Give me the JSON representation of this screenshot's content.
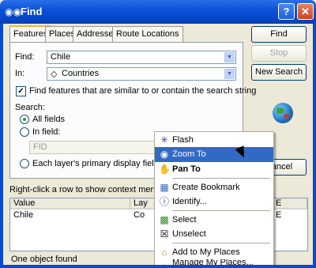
{
  "window": {
    "title": "Find",
    "help_glyph": "?",
    "close_glyph": "✕",
    "icon": "binoculars-icon"
  },
  "tabs": [
    {
      "label": "Features",
      "active": true
    },
    {
      "label": "Places",
      "active": false
    },
    {
      "label": "Addresses",
      "active": false
    },
    {
      "label": "Route Locations",
      "active": false
    }
  ],
  "form": {
    "find_label": "Find:",
    "find_value": "Chile",
    "in_label": "In:",
    "in_value": "Countries",
    "similar_checkbox_label": "Find features that are similar to or contain the search string",
    "similar_checked": true,
    "search_label": "Search:",
    "all_fields_label": "All fields",
    "in_field_label": "In field:",
    "in_field_value": "FID",
    "primary_display_label": "Each layer's primary display field"
  },
  "buttons": {
    "find": "Find",
    "stop": "Stop",
    "new_search": "New Search",
    "cancel": "Cancel"
  },
  "results": {
    "hint": "Right-click a row to show context menu.",
    "columns": [
      "Value",
      "Lay",
      "E"
    ],
    "rows": [
      [
        "Chile",
        "Co",
        "E"
      ]
    ],
    "status": "One object found"
  },
  "context_menu": {
    "items": [
      {
        "label": "Flash",
        "icon": "flash-icon"
      },
      {
        "label": "Zoom To",
        "icon": "zoom-to-icon",
        "highlighted": true
      },
      {
        "label": "Pan To",
        "icon": "hand-pan-icon",
        "bold": true
      },
      {
        "label": "Create Bookmark",
        "icon": "bookmark-icon"
      },
      {
        "label": "Identify...",
        "icon": "identify-icon"
      },
      {
        "label": "Select",
        "icon": "select-icon"
      },
      {
        "label": "Unselect",
        "icon": "unselect-icon"
      },
      {
        "label": "Add to My Places",
        "icon": "add-place-icon"
      },
      {
        "label": "Manage My Places...",
        "icon": "manage-places-icon"
      }
    ]
  },
  "colors": {
    "titlebar": "#0a4fd4",
    "highlight": "#316ac5",
    "dialog_bg": "#ece9d8"
  }
}
